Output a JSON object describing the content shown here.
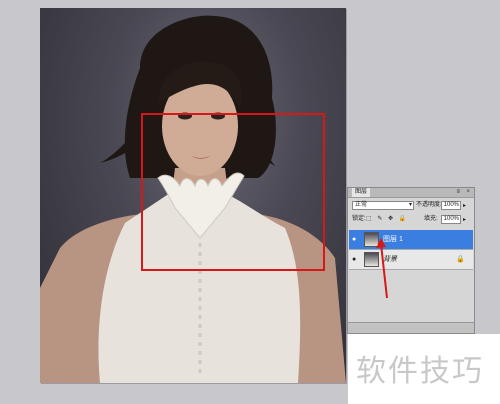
{
  "layers_panel": {
    "tab_label": "图层",
    "close_label": "×",
    "menu_label": "≡",
    "blend_mode": "正常",
    "opacity_label": "不透明度:",
    "opacity_value": "100%",
    "lock_label": "锁定:",
    "lock_icons": "⬚ ✎ ✥ 🔒",
    "fill_label": "填充:",
    "fill_value": "100%",
    "layers": [
      {
        "name": "图层 1",
        "selected": true
      },
      {
        "name": "背景",
        "selected": false
      }
    ]
  },
  "annotation": {
    "selection_color": "#d81818",
    "arrow_color": "#d81818"
  },
  "watermark": {
    "text": "软件技巧"
  }
}
